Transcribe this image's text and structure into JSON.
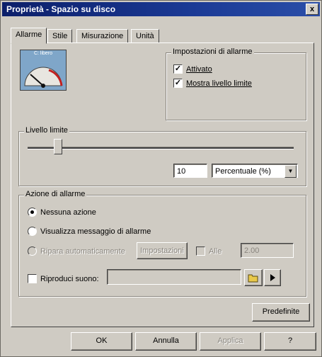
{
  "window": {
    "title": "Proprietà - Spazio su disco",
    "close_label": "x"
  },
  "tabs": [
    "Allarme",
    "Stile",
    "Misurazione",
    "Unità"
  ],
  "gauge": {
    "label": "C: libero"
  },
  "alarm_settings": {
    "title": "Impostazioni di allarme",
    "activated_label": "Attivato",
    "activated_checked": true,
    "show_limit_label": "Mostra livello limite",
    "show_limit_checked": true
  },
  "limit_level": {
    "title": "Livello limite",
    "slider_fraction": 0.1,
    "value": "10",
    "unit_selected": "Percentuale (%)"
  },
  "alarm_action": {
    "title": "Azione di allarme",
    "none_label": "Nessuna azione",
    "show_message_label": "Visualizza messaggio di allarme",
    "auto_repair_label": "Ripara automaticamente",
    "settings_button": "Impostazioni",
    "at_label": "Alle",
    "time_value": "2.00",
    "play_sound_label": "Riproduci suono:",
    "selected": "none"
  },
  "buttons": {
    "defaults": "Predefinite",
    "ok": "OK",
    "cancel": "Annulla",
    "apply": "Applica",
    "help": "?"
  },
  "colors": {
    "titlebar": "#0c1f6a",
    "face": "#cfcbc3",
    "gauge_needle": "#c22020"
  }
}
